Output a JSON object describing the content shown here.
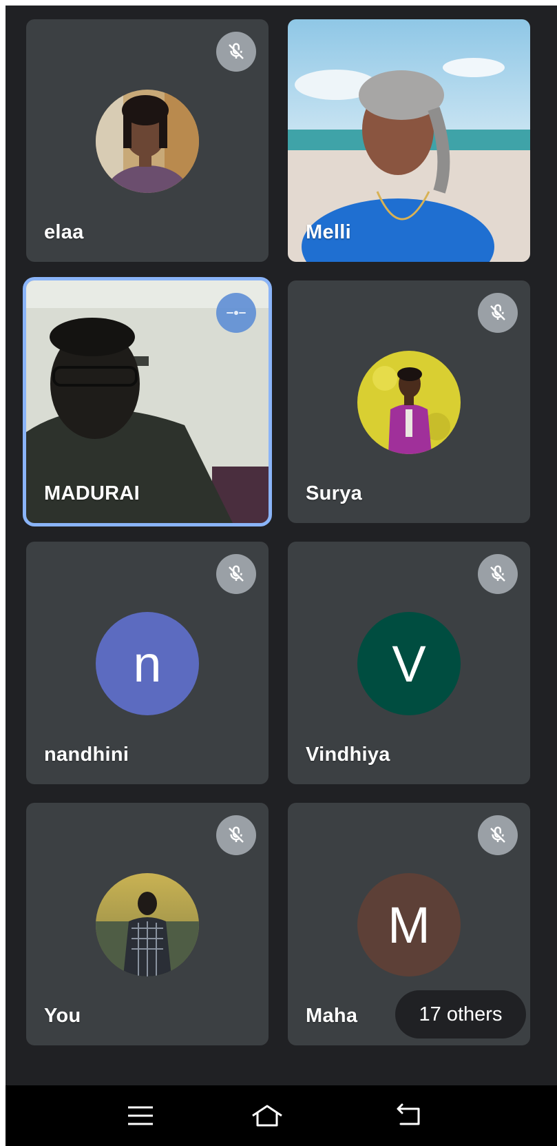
{
  "participants": [
    {
      "name": "elaa",
      "muted": true,
      "display": "photo"
    },
    {
      "name": "Melli",
      "muted": false,
      "display": "video"
    },
    {
      "name": "MADURAI",
      "muted": false,
      "display": "video",
      "speaking": true
    },
    {
      "name": "Surya",
      "muted": true,
      "display": "photo"
    },
    {
      "name": "nandhini",
      "muted": true,
      "display": "letter",
      "initial": "n",
      "color": "#5c6bc0"
    },
    {
      "name": "Vindhiya",
      "muted": true,
      "display": "letter",
      "initial": "V",
      "color": "#004d40"
    },
    {
      "name": "You",
      "muted": true,
      "display": "photo"
    },
    {
      "name": "Maha",
      "muted": true,
      "display": "letter",
      "initial": "M",
      "color": "#5d4037"
    }
  ],
  "others_label": "17 others",
  "icons": {
    "mute": "mic-off-icon",
    "speaking": "audio-indicator-icon",
    "menu": "recent-apps-icon",
    "home": "home-icon",
    "back": "back-icon"
  },
  "colors": {
    "background": "#202124",
    "tile": "#3c4043",
    "active_border": "#8ab4f8",
    "mute_badge": "#9aa0a6"
  }
}
